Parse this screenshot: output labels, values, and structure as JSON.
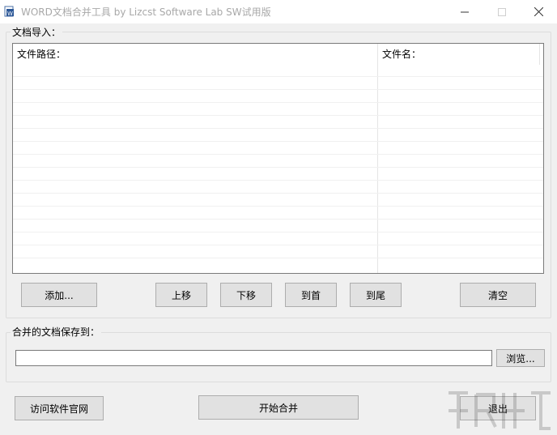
{
  "window": {
    "title": "WORD文档合并工具    by Lizcst Software Lab   SW试用版"
  },
  "import_group": {
    "label": "文档导入：",
    "list": {
      "columns": [
        "文件路径：",
        "文件名："
      ],
      "rows": []
    },
    "buttons": {
      "add": "添加...",
      "move_up": "上移",
      "move_down": "下移",
      "to_top": "到首",
      "to_bottom": "到尾",
      "clear": "清空"
    }
  },
  "save_group": {
    "label": "合并的文档保存到：",
    "path_value": "",
    "browse": "浏览..."
  },
  "footer": {
    "visit_site": "访问软件官网",
    "start_merge": "开始合并",
    "exit": "退出"
  },
  "colors": {
    "button_face": "#e1e1e1",
    "button_border": "#adadad",
    "window_bg": "#f0f0f0"
  }
}
